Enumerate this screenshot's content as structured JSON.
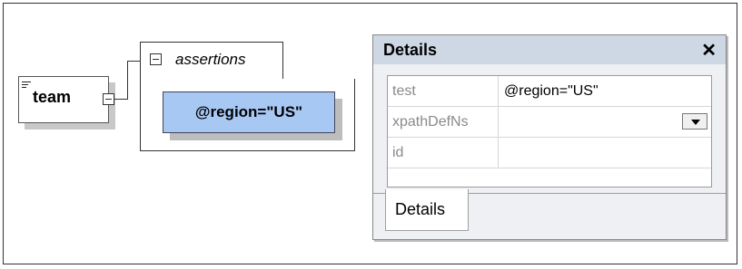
{
  "diagram": {
    "element": {
      "name": "team"
    },
    "assertions": {
      "label": "assertions",
      "items": [
        {
          "label": "@region=\"US\""
        }
      ]
    }
  },
  "details_panel": {
    "title": "Details",
    "close_glyph": "✕",
    "properties": [
      {
        "name": "test",
        "value": "@region=\"US\""
      },
      {
        "name": "xpathDefNs",
        "value": ""
      },
      {
        "name": "id",
        "value": ""
      }
    ],
    "tabs": [
      {
        "label": "Details",
        "active": true
      }
    ]
  }
}
